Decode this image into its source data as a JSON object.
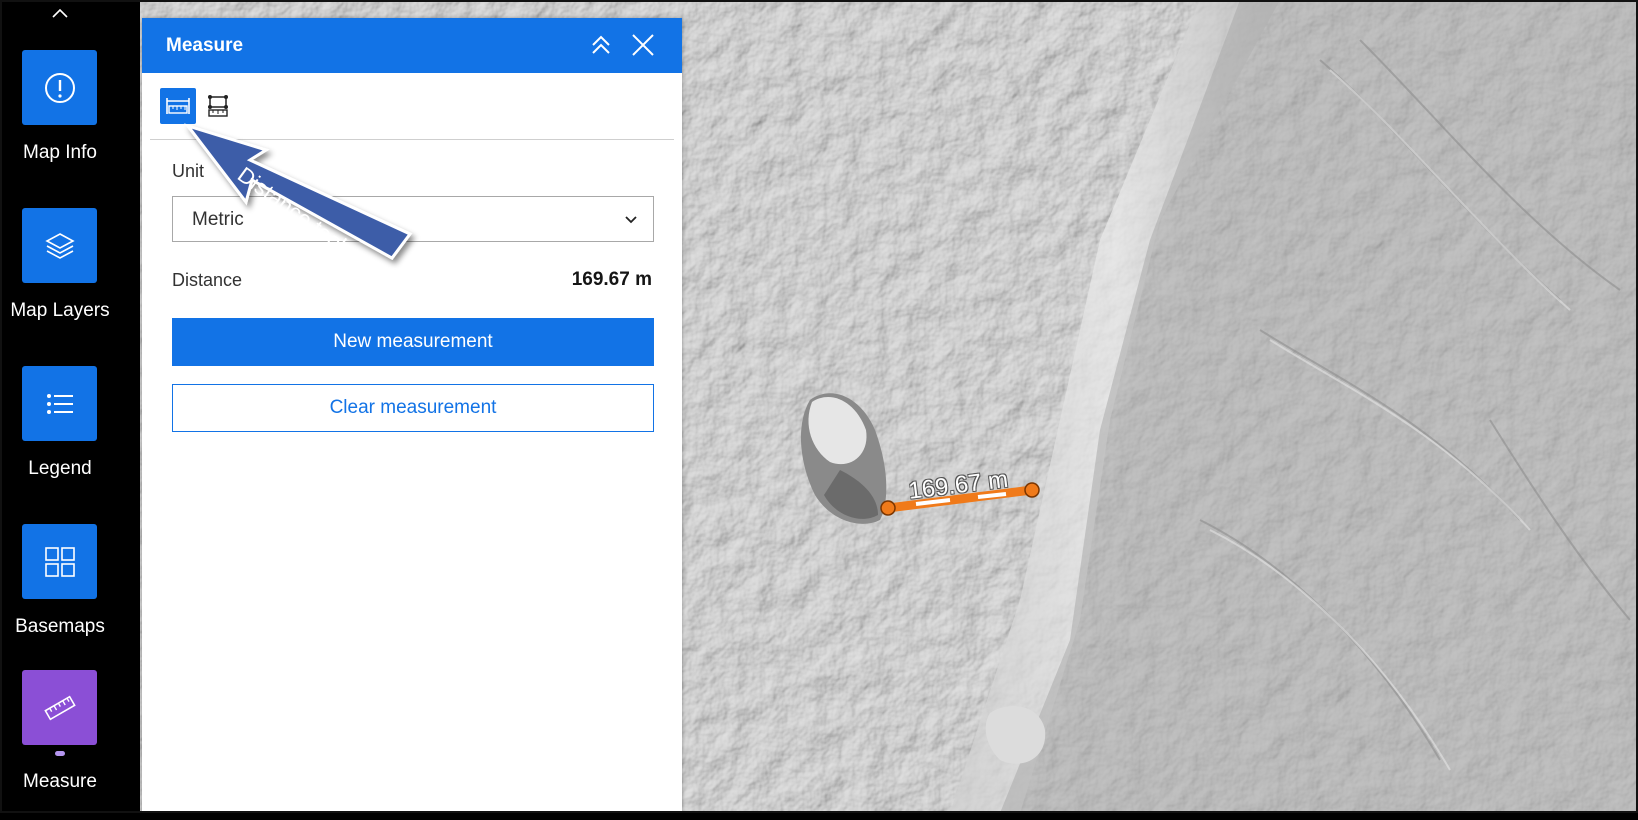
{
  "rail": {
    "items": [
      {
        "label": "Map Info",
        "icon": "info-icon"
      },
      {
        "label": "Map Layers",
        "icon": "layers-icon"
      },
      {
        "label": "Legend",
        "icon": "legend-icon"
      },
      {
        "label": "Basemaps",
        "icon": "basemaps-icon"
      },
      {
        "label": "Measure",
        "icon": "ruler-icon",
        "active": true
      }
    ]
  },
  "panel": {
    "title": "Measure",
    "tools": [
      "distance-tool-icon",
      "area-tool-icon"
    ],
    "unit_label": "Unit",
    "unit_value": "Metric",
    "distance_label": "Distance",
    "distance_value": "169.67 m",
    "new_button": "New measurement",
    "clear_button": "Clear measurement"
  },
  "callout": {
    "text": "Distance tool"
  },
  "map": {
    "measurement_label": "169.67 m"
  },
  "colors": {
    "accent": "#1273e6",
    "active_rail": "#8b4fd6",
    "measure_line": "#f07a1a",
    "callout": "#3d5da8"
  }
}
